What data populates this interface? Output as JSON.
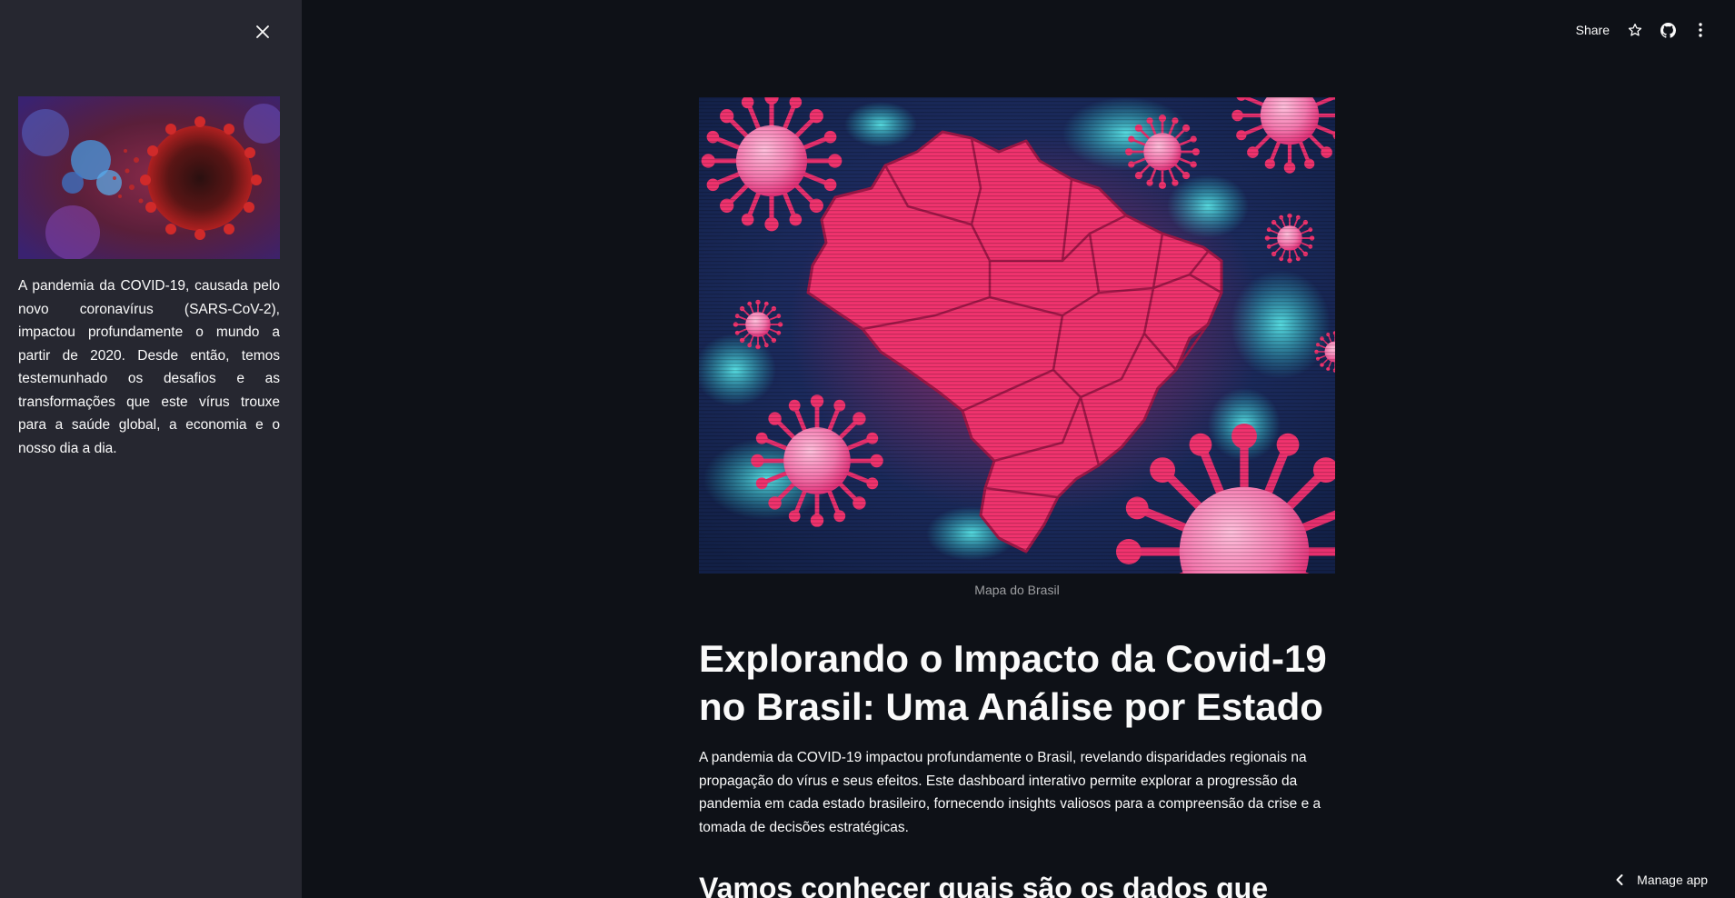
{
  "sidebar": {
    "image_alt": "Ilustração microscópica do coronavírus",
    "description": "A pandemia da COVID-19, causada pelo novo coronavírus (SARS-CoV-2), impactou profundamente o mundo a partir de 2020. Desde então, temos testemunhado os desafios e as transformações que este vírus trouxe para a saúde global, a economia e o nosso dia a dia.",
    "close_icon": "close-icon"
  },
  "header": {
    "share_label": "Share",
    "icons": [
      "star-icon",
      "github-icon",
      "more-vertical-icon"
    ]
  },
  "main": {
    "image_alt": "Mapa do Brasil",
    "image_caption": "Mapa do Brasil",
    "title": "Explorando o Impacto da Covid-19 no Brasil: Uma Análise por Estado",
    "intro": "A pandemia da COVID-19 impactou profundamente o Brasil, revelando disparidades regionais na propagação do vírus e seus efeitos. Este dashboard interativo permite explorar a progressão da pandemia em cada estado brasileiro, fornecendo insights valiosos para a compreensão da crise e a tomada de decisões estratégicas.",
    "subheading": "Vamos conhecer quais são os dados que"
  },
  "footer": {
    "manage_app_label": "Manage app",
    "manage_icon": "chevron-left-icon"
  },
  "colors": {
    "background": "#0e1117",
    "sidebar": "#262730",
    "virus_pink": "#f0336e",
    "virus_teal": "#27c6cf",
    "image_navy": "#1b2a5c"
  }
}
